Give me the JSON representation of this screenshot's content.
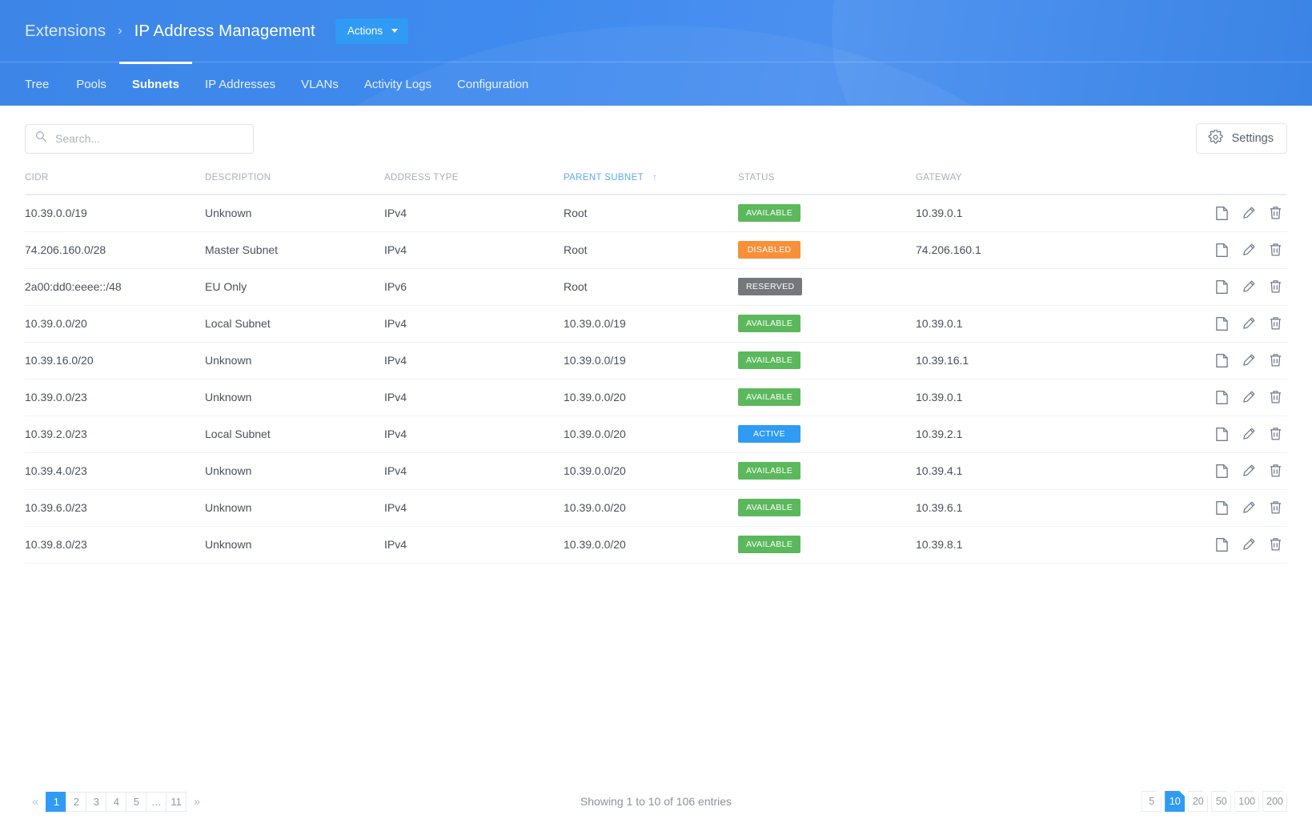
{
  "header": {
    "breadcrumb_root": "Extensions",
    "breadcrumb_sep": "›",
    "breadcrumb_current": "IP Address Management",
    "actions_label": "Actions",
    "tabs": [
      {
        "label": "Tree",
        "active": false
      },
      {
        "label": "Pools",
        "active": false
      },
      {
        "label": "Subnets",
        "active": true
      },
      {
        "label": "IP Addresses",
        "active": false
      },
      {
        "label": "VLANs",
        "active": false
      },
      {
        "label": "Activity Logs",
        "active": false
      },
      {
        "label": "Configuration",
        "active": false
      }
    ]
  },
  "toolbar": {
    "search_placeholder": "Search...",
    "search_value": "",
    "settings_label": "Settings"
  },
  "table": {
    "columns": [
      {
        "label": "CIDR",
        "sorted": false
      },
      {
        "label": "DESCRIPTION",
        "sorted": false
      },
      {
        "label": "ADDRESS TYPE",
        "sorted": false
      },
      {
        "label": "PARENT SUBNET",
        "sorted": true,
        "sort_dir": "↑"
      },
      {
        "label": "STATUS",
        "sorted": false
      },
      {
        "label": "GATEWAY",
        "sorted": false
      },
      {
        "label": "",
        "sorted": false
      }
    ],
    "status_colors": {
      "AVAILABLE": "#5cb85c",
      "DISABLED": "#f79038",
      "RESERVED": "#74787c",
      "ACTIVE": "#2f9bf5"
    },
    "row_icons": [
      "copy-icon",
      "edit-icon",
      "delete-icon"
    ],
    "rows": [
      {
        "cidr": "10.39.0.0/19",
        "description": "Unknown",
        "address_type": "IPv4",
        "parent_subnet": "Root",
        "status": "AVAILABLE",
        "gateway": "10.39.0.1"
      },
      {
        "cidr": "74.206.160.0/28",
        "description": "Master Subnet",
        "address_type": "IPv4",
        "parent_subnet": "Root",
        "status": "DISABLED",
        "gateway": "74.206.160.1"
      },
      {
        "cidr": "2a00:dd0:eeee::/48",
        "description": "EU Only",
        "address_type": "IPv6",
        "parent_subnet": "Root",
        "status": "RESERVED",
        "gateway": ""
      },
      {
        "cidr": "10.39.0.0/20",
        "description": "Local Subnet",
        "address_type": "IPv4",
        "parent_subnet": "10.39.0.0/19",
        "status": "AVAILABLE",
        "gateway": "10.39.0.1"
      },
      {
        "cidr": "10.39.16.0/20",
        "description": "Unknown",
        "address_type": "IPv4",
        "parent_subnet": "10.39.0.0/19",
        "status": "AVAILABLE",
        "gateway": "10.39.16.1"
      },
      {
        "cidr": "10.39.0.0/23",
        "description": "Unknown",
        "address_type": "IPv4",
        "parent_subnet": "10.39.0.0/20",
        "status": "AVAILABLE",
        "gateway": "10.39.0.1"
      },
      {
        "cidr": "10.39.2.0/23",
        "description": "Local Subnet",
        "address_type": "IPv4",
        "parent_subnet": "10.39.0.0/20",
        "status": "ACTIVE",
        "gateway": "10.39.2.1"
      },
      {
        "cidr": "10.39.4.0/23",
        "description": "Unknown",
        "address_type": "IPv4",
        "parent_subnet": "10.39.0.0/20",
        "status": "AVAILABLE",
        "gateway": "10.39.4.1"
      },
      {
        "cidr": "10.39.6.0/23",
        "description": "Unknown",
        "address_type": "IPv4",
        "parent_subnet": "10.39.0.0/20",
        "status": "AVAILABLE",
        "gateway": "10.39.6.1"
      },
      {
        "cidr": "10.39.8.0/23",
        "description": "Unknown",
        "address_type": "IPv4",
        "parent_subnet": "10.39.0.0/20",
        "status": "AVAILABLE",
        "gateway": "10.39.8.1"
      }
    ]
  },
  "footer": {
    "prev_glyph": "«",
    "next_glyph": "»",
    "pages": [
      "1",
      "2",
      "3",
      "4",
      "5",
      "…",
      "11"
    ],
    "active_page": "1",
    "showing_text": "Showing 1 to 10 of 106 entries",
    "page_sizes": [
      "5",
      "10",
      "20",
      "50",
      "100",
      "200"
    ],
    "active_page_size": "10"
  }
}
